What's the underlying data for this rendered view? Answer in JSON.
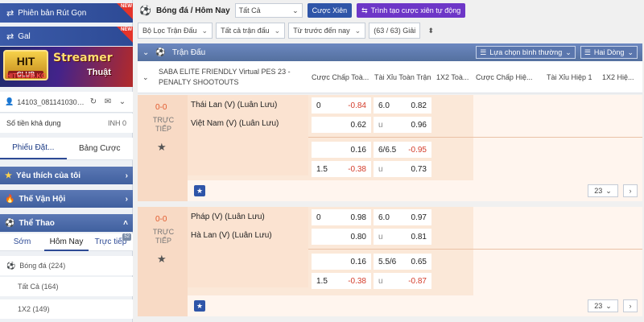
{
  "sidebar": {
    "promo1": {
      "label": "Phiên bản Rút Gọn",
      "badge": "NEW"
    },
    "promo2": {
      "label": "Gal",
      "badge": "NEW"
    },
    "banner": {
      "logo_top": "HIT",
      "logo_sub": "CLUB",
      "title": "Streamer",
      "subtitle": "Thuật",
      "brand": "HITCLUB.KG"
    },
    "account": {
      "user_id": "14103_0811410301..."
    },
    "balance": {
      "label": "Số tiền khả dụng",
      "currency": "INH 0"
    },
    "bet_tabs": [
      "Phiếu Đặt...",
      "Bảng Cược"
    ],
    "nav": {
      "favorites": "Yêu thích của tôi",
      "olympics": "Thế Vận Hội",
      "sports": "Thể Thao"
    },
    "sport_tabs": {
      "early": "Sớm",
      "today": "Hôm Nay",
      "live": "Trực tiếp",
      "live_count": "52"
    },
    "sport_items": {
      "football": "Bóng đá (224)",
      "all": "Tất Cả (164)",
      "x12": "1X2 (149)"
    }
  },
  "topbar": {
    "breadcrumb": "Bóng đá / Hôm Nay",
    "market_select": "Tất Cả",
    "parlay_button": "Cược Xiên",
    "auto_parlay_button": "Trình tạo cược xiên tự động"
  },
  "filters": {
    "league": "Bộ Lọc Trận Đấu",
    "bet_type": "Tất cả trận đấu",
    "time": "Từ trước đến nay",
    "count": "(63 / 63) Giải"
  },
  "table": {
    "title": "Trận Đấu",
    "odds_view": "Lựa chọn bình thường",
    "lines": "Hai Dòng",
    "league_name": "SABA ELITE FRIENDLY Virtual PES 23 - PENALTY SHOOTOUTS",
    "columns": [
      "Cược Chấp Toà...",
      "Tài Xỉu Toàn Trận",
      "1X2 Toà...",
      "Cược Chấp Hiệ...",
      "Tài Xỉu Hiệp 1",
      "1X2 Hiệ..."
    ]
  },
  "matches": [
    {
      "score": "0-0",
      "status": "TRỰC TIẾP",
      "home": "Thái Lan (V) (Luân Lưu)",
      "away": "Việt Nam (V) (Luân Lưu)",
      "rows": [
        {
          "hdp_line": "0",
          "hdp_odds": "-0.84",
          "ou_line": "6.0",
          "ou_odds": "0.82"
        },
        {
          "hdp_line": "",
          "hdp_odds": "0.62",
          "ou_line": "u",
          "ou_odds": "0.96"
        },
        {
          "hdp_line": "",
          "hdp_odds": "0.16",
          "ou_line": "6/6.5",
          "ou_odds": "-0.95"
        },
        {
          "hdp_line": "1.5",
          "hdp_odds": "-0.38",
          "ou_line": "u",
          "ou_odds": "0.73"
        }
      ],
      "more": "23"
    },
    {
      "score": "0-0",
      "status": "TRỰC TIẾP",
      "home": "Pháp (V) (Luân Lưu)",
      "away": "Hà Lan (V) (Luân Lưu)",
      "rows": [
        {
          "hdp_line": "0",
          "hdp_odds": "0.98",
          "ou_line": "6.0",
          "ou_odds": "0.97"
        },
        {
          "hdp_line": "",
          "hdp_odds": "0.80",
          "ou_line": "u",
          "ou_odds": "0.81"
        },
        {
          "hdp_line": "",
          "hdp_odds": "0.16",
          "ou_line": "5.5/6",
          "ou_odds": "0.65"
        },
        {
          "hdp_line": "1.5",
          "hdp_odds": "-0.38",
          "ou_line": "u",
          "ou_odds": "-0.87"
        }
      ],
      "more": "23"
    }
  ]
}
